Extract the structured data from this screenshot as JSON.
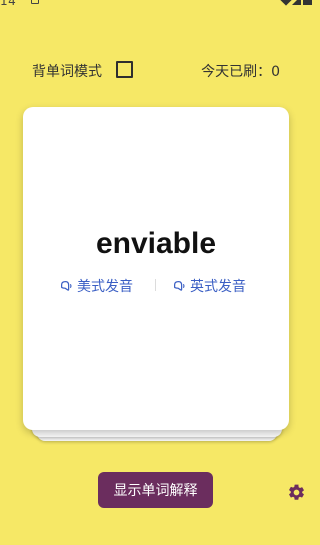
{
  "status_bar": {
    "time": "14"
  },
  "top": {
    "mode_label": "背单词模式",
    "mode_checked": false,
    "today_count": "今天已刷：0"
  },
  "card": {
    "word": "enviable",
    "us_pron_label": "美式发音",
    "uk_pron_label": "英式发音"
  },
  "bottom": {
    "show_button_label": "显示单词解释"
  },
  "colors": {
    "background": "#f6e866",
    "button": "#6b2d5e",
    "link": "#3b5fc4"
  },
  "icons": [
    "speaker-icon",
    "gear-icon",
    "checkbox-icon"
  ]
}
